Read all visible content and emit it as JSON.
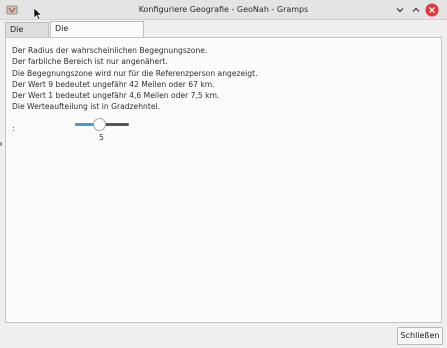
{
  "window": {
    "title": "Konfiguriere Geografie - GeoNah - Gramps"
  },
  "tabs": [
    {
      "label": "Die Karte",
      "active": false
    },
    {
      "label": "Die Auswahlparameter",
      "active": true
    }
  ],
  "description": {
    "lines": [
      "Der Radius der wahrscheinlichen Begegnungszone.",
      "Der farbliche Bereich ist nur angenähert.",
      "Die Begegnungszone wird nur für die Referenzperson angezeigt.",
      "Der Wert 9 bedeutet ungefähr 42 Meilen oder 67 km.",
      "Der Wert 1 bedeutet ungefähr 4,6 Meilen oder 7,5 km.",
      "Die Werteaufteilung ist in Gradzehntel."
    ]
  },
  "field": {
    "label": ":",
    "slider": {
      "value": "5",
      "fraction": 0.44
    }
  },
  "footer": {
    "close_label": "Schließen"
  },
  "colors": {
    "accent": "#3a9de0",
    "close": "#e0383b"
  }
}
